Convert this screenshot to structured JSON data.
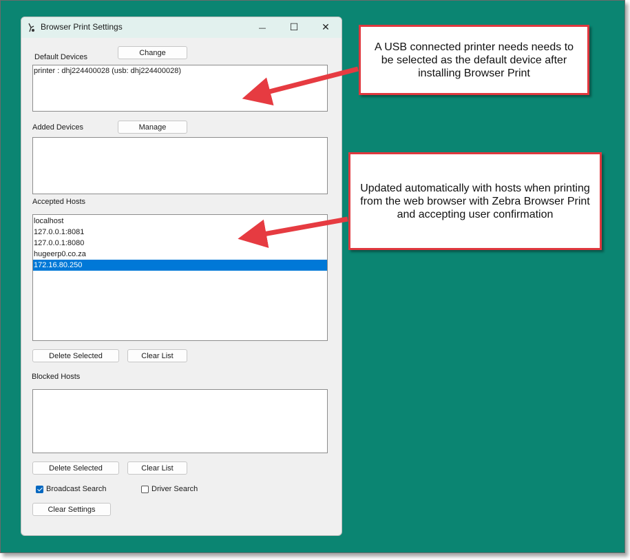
{
  "window": {
    "title": "Browser Print Settings",
    "minimize_glyph": "—",
    "maximize_glyph": "☐",
    "close_glyph": "✕"
  },
  "default_devices": {
    "label": "Default Devices",
    "button": "Change",
    "items": [
      "printer : dhj224400028 (usb: dhj224400028)"
    ]
  },
  "added_devices": {
    "label": "Added Devices",
    "button": "Manage",
    "items": []
  },
  "accepted_hosts": {
    "label": "Accepted Hosts",
    "items": [
      "localhost",
      "127.0.0.1:8081",
      "127.0.0.1:8080",
      "hugeerp0.co.za",
      "172.16.80.250"
    ],
    "selected_index": 4,
    "delete_button": "Delete Selected",
    "clear_button": "Clear List"
  },
  "blocked_hosts": {
    "label": "Blocked Hosts",
    "items": [],
    "delete_button": "Delete Selected",
    "clear_button": "Clear List"
  },
  "options": {
    "broadcast_search": {
      "label": "Broadcast Search",
      "checked": true
    },
    "driver_search": {
      "label": "Driver Search",
      "checked": false
    },
    "clear_settings_button": "Clear Settings"
  },
  "callouts": {
    "usb_note": "A USB connected printer needs needs to be selected as the default device after installing Browser Print",
    "hosts_note": "Updated automatically with hosts when printing from the web browser with Zebra Browser Print and accepting user confirmation"
  },
  "colors": {
    "background": "#0b8572",
    "callout_border": "#e0383e",
    "selection": "#0078d7"
  }
}
